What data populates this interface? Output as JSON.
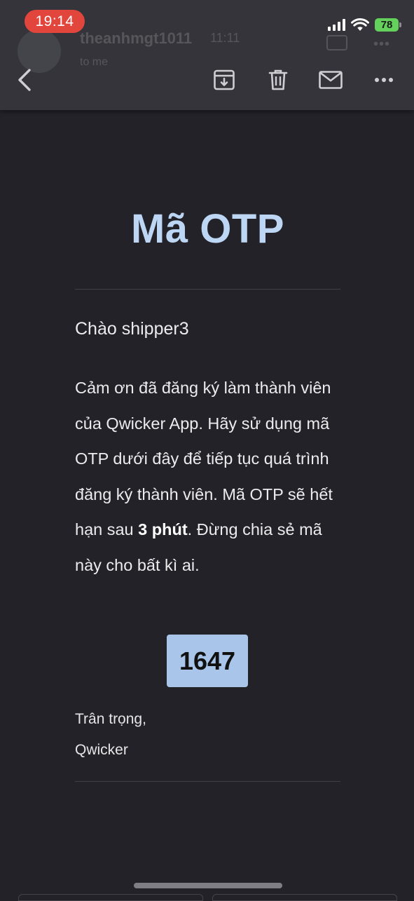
{
  "status_bar": {
    "time": "19:14",
    "battery": "78"
  },
  "ghost_header": {
    "sender": "theanhmgt1011",
    "time": "11:11",
    "to": "to me"
  },
  "toolbar": {
    "back": "back-icon",
    "archive": "archive-icon",
    "delete": "trash-icon",
    "mark_unread": "mail-icon",
    "more": "more-icon"
  },
  "email": {
    "title": "Mã OTP",
    "greeting": "Chào shipper3",
    "body_before_bold": "Cảm ơn đã đăng ký làm thành viên của Qwicker App. Hãy sử dụng mã OTP dưới đây để tiếp tục quá trình đăng ký thành viên. Mã OTP sẽ hết hạn sau ",
    "body_bold": "3 phút",
    "body_after_bold": ". Đừng chia sẻ mã này cho bất kì ai.",
    "otp_code": "1647",
    "signoff": "Trân trọng,",
    "signature": "Qwicker"
  },
  "colors": {
    "title": "#bcd6f4",
    "otp_bg": "#a9c6ea",
    "time_pill": "#e2453c",
    "battery": "#64d15c"
  }
}
